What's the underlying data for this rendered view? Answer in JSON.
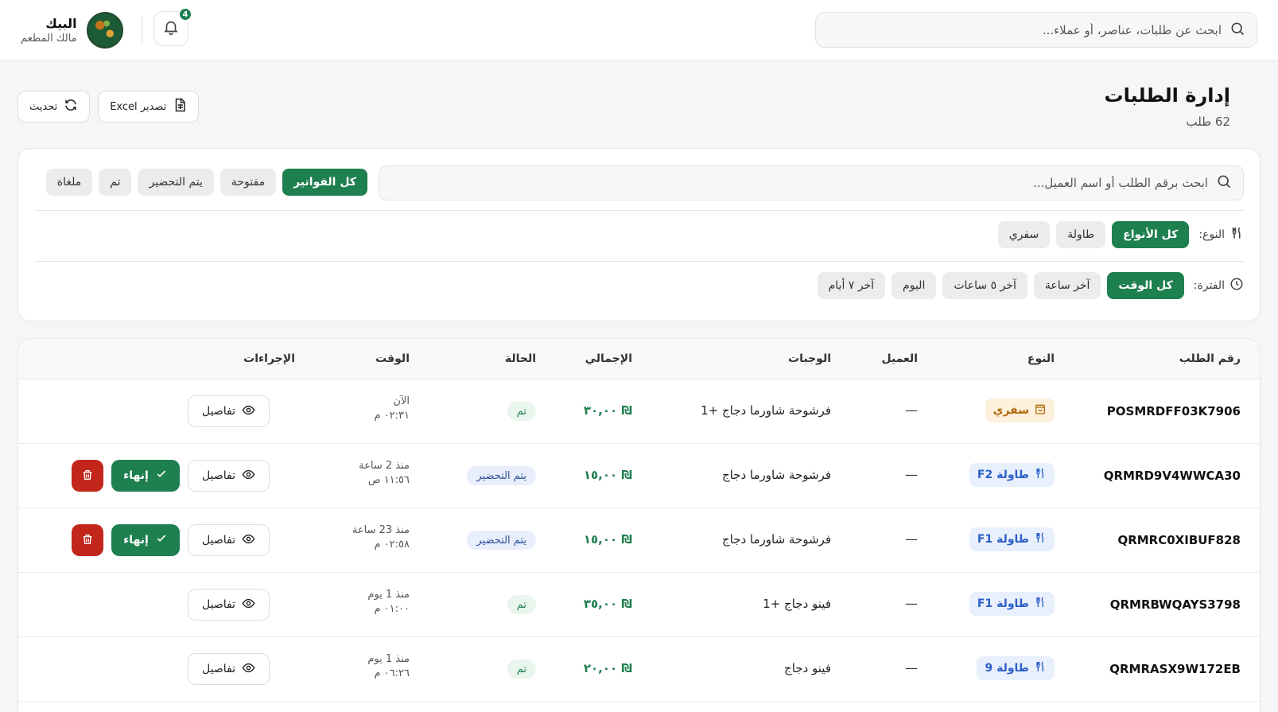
{
  "topbar": {
    "search_placeholder": "ابحث عن طلبات، عناصر، أو عملاء...",
    "notification_count": "4",
    "user_name": "البيك",
    "user_role": "مالك المطعم"
  },
  "page": {
    "title": "إدارة الطلبات",
    "subtitle": "62 طلب",
    "export_label": "تصدير Excel",
    "refresh_label": "تحديث"
  },
  "filters": {
    "search_placeholder": "ابحث برقم الطلب أو اسم العميل...",
    "status_pills": [
      "كل الفواتير",
      "مفتوحة",
      "يتم التحضير",
      "تم",
      "ملغاة"
    ],
    "type_label": "النوع:",
    "type_pills": [
      "كل الأنواع",
      "طاولة",
      "سفري"
    ],
    "period_label": "الفترة:",
    "period_pills": [
      "كل الوقت",
      "آخر ساعة",
      "آخر ٥ ساعات",
      "اليوم",
      "آخر ٧ أيام"
    ]
  },
  "table": {
    "headers": {
      "order_id": "رقم الطلب",
      "type": "النوع",
      "customer": "العميل",
      "meals": "الوجبات",
      "total": "الإجمالي",
      "status": "الحالة",
      "time": "الوقت",
      "actions": "الإجراءات"
    },
    "details_label": "تفاصيل",
    "finish_label": "إنهاء",
    "rows": [
      {
        "order_id": "POSMRDFF03K7906",
        "type": "سفري",
        "type_kind": "safari",
        "customer": "—",
        "meals": "فرشوحة شاورما دجاج +1",
        "total": "₪ ٣٠,٠٠",
        "status": "تم",
        "status_kind": "done",
        "time_ago": "الآن",
        "time": "٠٢:٣١ م",
        "can_finish": false
      },
      {
        "order_id": "QRMRD9V4WWCA30",
        "type": "طاولة F2",
        "type_kind": "table",
        "customer": "—",
        "meals": "فرشوحة شاورما دجاج",
        "total": "₪ ١٥,٠٠",
        "status": "يتم التحضير",
        "status_kind": "prep",
        "time_ago": "منذ 2 ساعة",
        "time": "١١:٥٦ ص",
        "can_finish": true
      },
      {
        "order_id": "QRMRC0XIBUF828",
        "type": "طاولة F1",
        "type_kind": "table",
        "customer": "—",
        "meals": "فرشوحة شاورما دجاج",
        "total": "₪ ١٥,٠٠",
        "status": "يتم التحضير",
        "status_kind": "prep",
        "time_ago": "منذ 23 ساعة",
        "time": "٠٢:٥٨ م",
        "can_finish": true
      },
      {
        "order_id": "QRMRBWQAYS3798",
        "type": "طاولة F1",
        "type_kind": "table",
        "customer": "—",
        "meals": "فينو دجاج +1",
        "total": "₪ ٣٥,٠٠",
        "status": "تم",
        "status_kind": "done",
        "time_ago": "منذ 1 يوم",
        "time": "٠١:٠٠ م",
        "can_finish": false
      },
      {
        "order_id": "QRMRASX9W172EB",
        "type": "طاولة 9",
        "type_kind": "table",
        "customer": "—",
        "meals": "فينو دجاج",
        "total": "₪ ٢٠,٠٠",
        "status": "تم",
        "status_kind": "done",
        "time_ago": "منذ 1 يوم",
        "time": "٠٦:٢٦ م",
        "can_finish": false
      }
    ]
  },
  "colors": {
    "primary": "#1e7f4f",
    "danger": "#c2261b",
    "table_badge": "#2c5fc8",
    "safari_badge": "#b26b0a"
  }
}
